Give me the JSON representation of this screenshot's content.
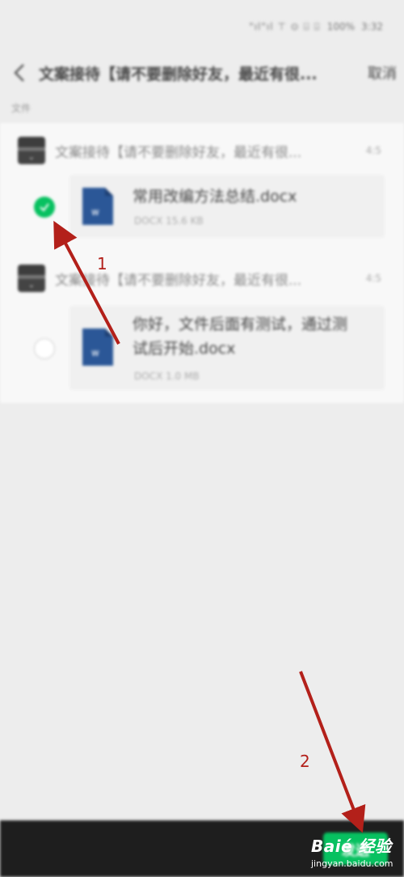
{
  "status_bar": {
    "signal": "\"ıl\"ıl ⊤ ⊙ ⌸ ⌹",
    "battery": "100%",
    "time": "3:32"
  },
  "nav": {
    "back_icon": "chevron-left-icon",
    "title": "文案接待【请不要删除好友，最近有很...",
    "cancel_label": "取消"
  },
  "section_label": "文件",
  "groups": [
    {
      "sender": "文案接待【请不要删除好友，最近有很...",
      "time": "4:5",
      "file": {
        "name_lines": [
          "常用改编方法总结.docx"
        ],
        "meta": "DOCX 15.6 KB",
        "selected": true
      }
    },
    {
      "sender": "文案接待【请不要删除好友，最近有很...",
      "time": "4:5",
      "file": {
        "name_lines": [
          "你好，文件后面有测试，通过测",
          "试后开始.docx"
        ],
        "meta": "DOCX 1.0 MB",
        "selected": false
      }
    }
  ],
  "bottom_bar": {
    "send_label": "发送"
  },
  "annotations": {
    "label_1": "1",
    "label_2": "2",
    "arrow_color": "#b3201a",
    "watermark_main": "Baié 经验",
    "watermark_sub": "jingyan.baidu.com"
  },
  "colors": {
    "accent": "#07c160",
    "doc_icon": "#2b5797",
    "bottom_bar": "#1e1e1e"
  }
}
